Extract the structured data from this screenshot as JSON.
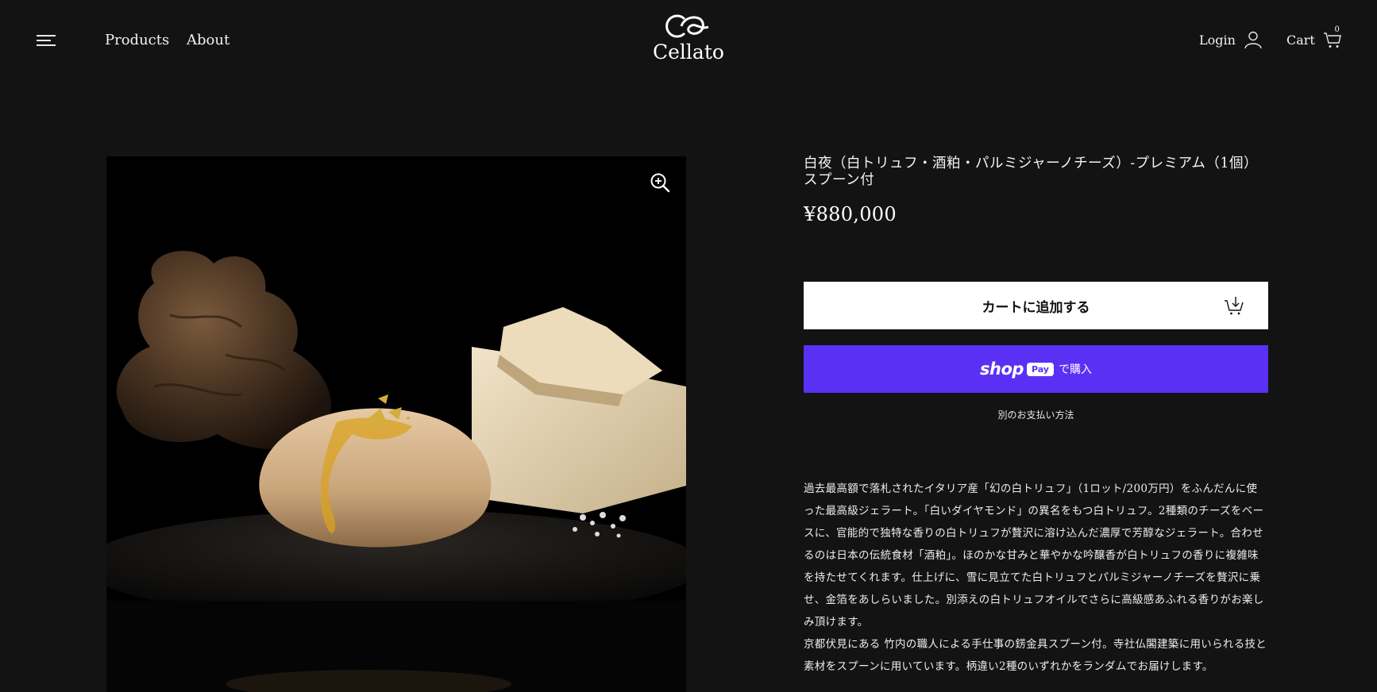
{
  "header": {
    "nav": [
      {
        "label": "Products"
      },
      {
        "label": "About"
      }
    ],
    "logo_text": "Cellato",
    "login_label": "Login",
    "cart_label": "Cart",
    "cart_count": "0"
  },
  "product": {
    "title": "白夜（白トリュフ・酒粕・パルミジャーノチーズ）-プレミアム（1個）スプーン付",
    "price": "¥880,000",
    "add_to_cart_label": "カートに追加する",
    "shop_pay": {
      "brand": "shop",
      "badge": "Pay",
      "suffix": "で購入"
    },
    "other_payment_label": "別のお支払い方法",
    "description": [
      "過去最高額で落札されたイタリア産「幻の白トリュフ」（1ロット/200万円）をふんだんに使った最高級ジェラート。「白いダイヤモンド」の異名をもつ白トリュフ。2種類のチーズをベースに、官能的で独特な香りの白トリュフが贅沢に溶け込んだ濃厚で芳醇なジェラート。合わせるのは日本の伝統食材「酒粕」。ほのかな甘みと華やかな吟醸香が白トリュフの香りに複雑味を持たせてくれます。仕上げに、雪に見立てた白トリュフとパルミジャーノチーズを贅沢に乗せ、金箔をあしらいました。別添えの白トリュフオイルでさらに高級感あふれる香りがお楽しみ頂けます。",
      "京都伏見にある 竹内の職人による手仕事の錺金具スプーン付。寺社仏閣建築に用いられる技と素材をスプーンに用いています。柄違い2種のいずれかをランダムでお届けします。"
    ]
  },
  "colors": {
    "background": "#131313",
    "shop_pay": "#5a31f4",
    "button_light": "#ffffff"
  },
  "icons": [
    "menu-icon",
    "user-icon",
    "cart-icon",
    "zoom-in-icon",
    "cart-add-icon"
  ]
}
